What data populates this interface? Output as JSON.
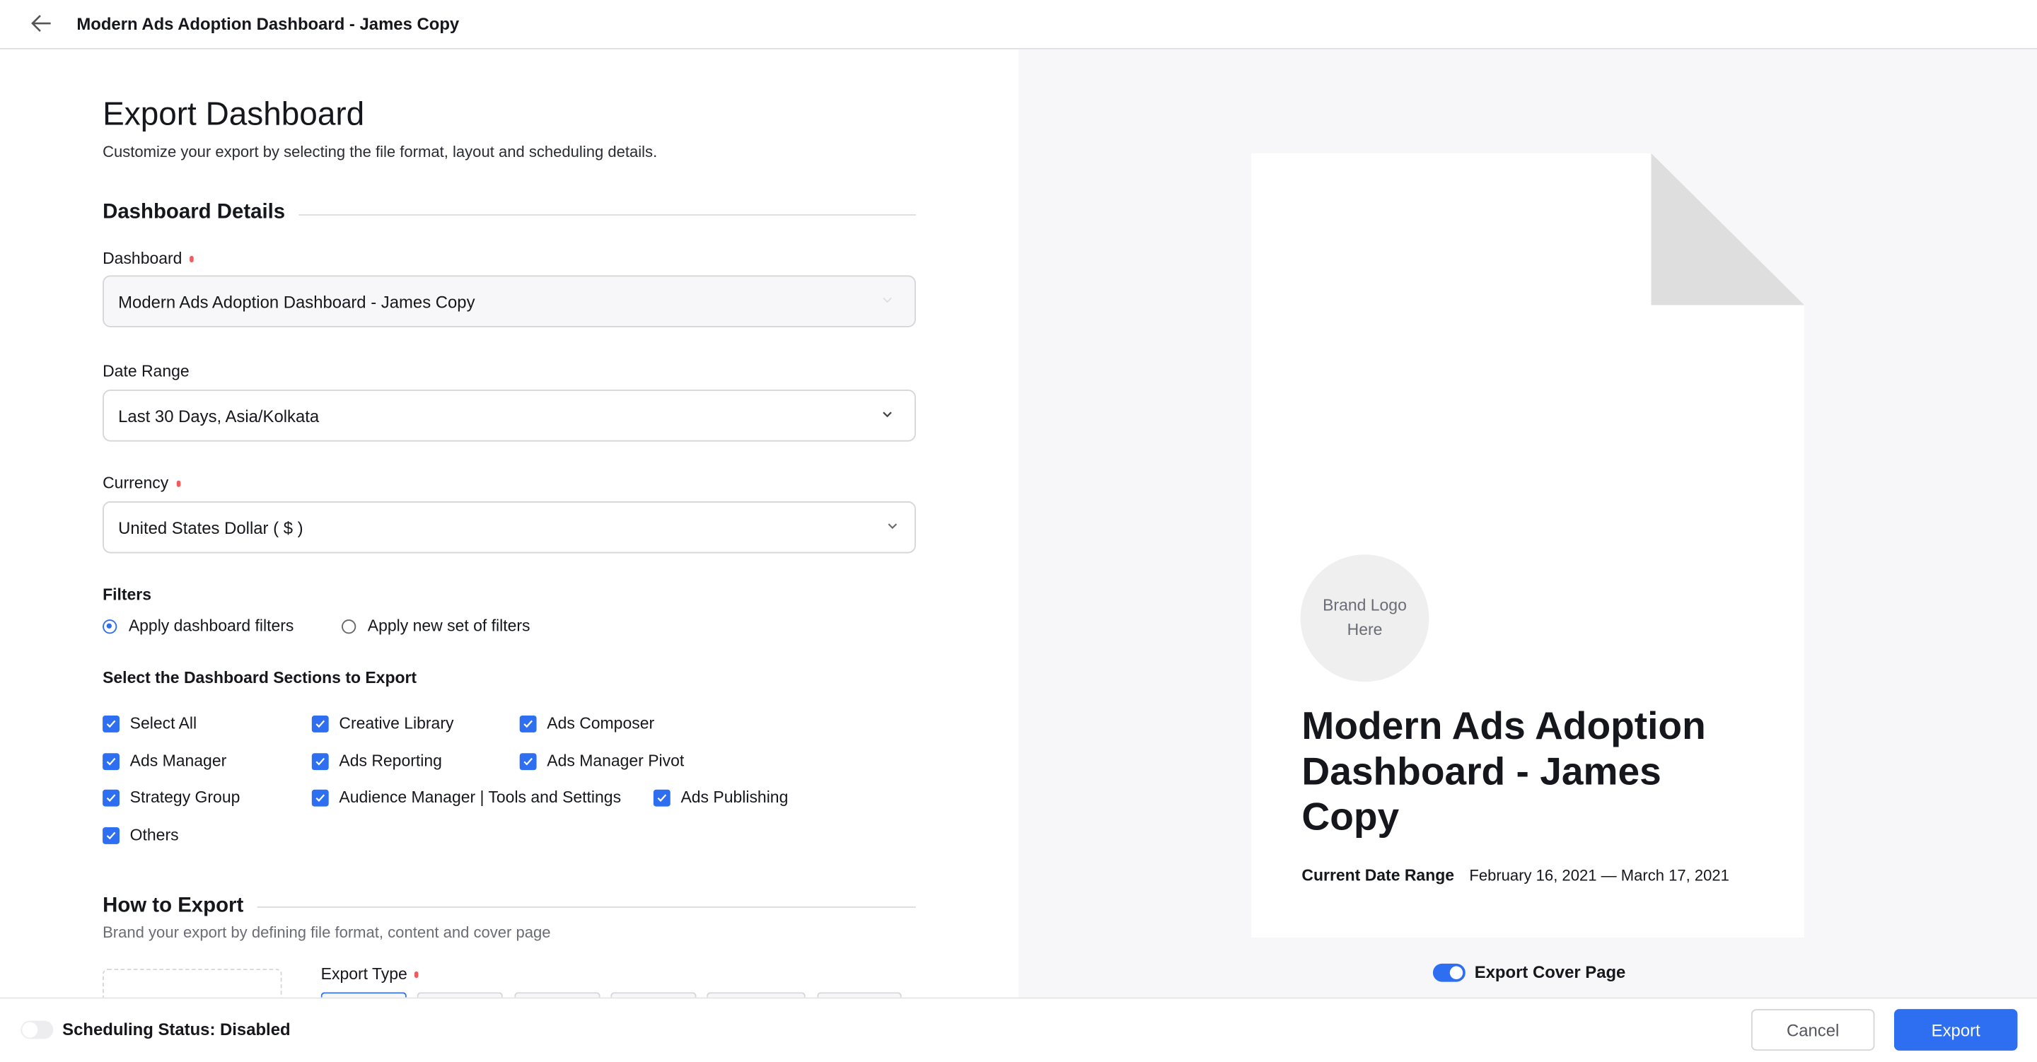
{
  "header": {
    "title": "Modern Ads Adoption Dashboard - James Copy",
    "back_icon": "arrow-left-icon"
  },
  "page": {
    "title": "Export Dashboard",
    "subtitle": "Customize your export by selecting the file format, layout and scheduling details."
  },
  "details": {
    "heading": "Dashboard Details",
    "dashboard": {
      "label": "Dashboard",
      "value": "Modern Ads Adoption Dashboard - James Copy",
      "required": true,
      "disabled": true
    },
    "date_range": {
      "label": "Date Range",
      "value": "Last 30 Days, Asia/Kolkata"
    },
    "currency": {
      "label": "Currency",
      "value": "United States Dollar ( $ )",
      "required": true
    }
  },
  "filters": {
    "label": "Filters",
    "options": [
      {
        "label": "Apply dashboard filters",
        "selected": true
      },
      {
        "label": "Apply new set of filters",
        "selected": false
      }
    ]
  },
  "sections": {
    "heading": "Select the Dashboard Sections to Export",
    "items": [
      {
        "label": "Select All",
        "checked": true
      },
      {
        "label": "Creative Library",
        "checked": true
      },
      {
        "label": "Ads Composer",
        "checked": true
      },
      {
        "label": "Ads Manager",
        "checked": true
      },
      {
        "label": "Ads Reporting",
        "checked": true
      },
      {
        "label": "Ads Manager Pivot",
        "checked": true
      },
      {
        "label": "Strategy Group",
        "checked": true
      },
      {
        "label": "Audience Manager | Tools and Settings",
        "checked": true
      },
      {
        "label": "Ads Publishing",
        "checked": true
      },
      {
        "label": "Others",
        "checked": true
      }
    ]
  },
  "how": {
    "heading": "How to Export",
    "subtitle": "Brand your export by defining file format, content and cover page",
    "export_type_label": "Export Type"
  },
  "preview": {
    "logo_line1": "Brand Logo",
    "logo_line2": "Here",
    "title": "Modern Ads Adoption Dashboard - James Copy",
    "date_label": "Current Date Range",
    "date_value": "February 16, 2021 — March 17, 2021",
    "cover_toggle_label": "Export Cover Page",
    "cover_enabled": true
  },
  "footer": {
    "scheduling_label": "Scheduling Status: Disabled",
    "scheduling_enabled": false,
    "cancel": "Cancel",
    "export": "Export"
  },
  "colors": {
    "accent": "#2e6ff2",
    "required": "#f15b5b",
    "panel_bg": "#f7f7f9"
  }
}
